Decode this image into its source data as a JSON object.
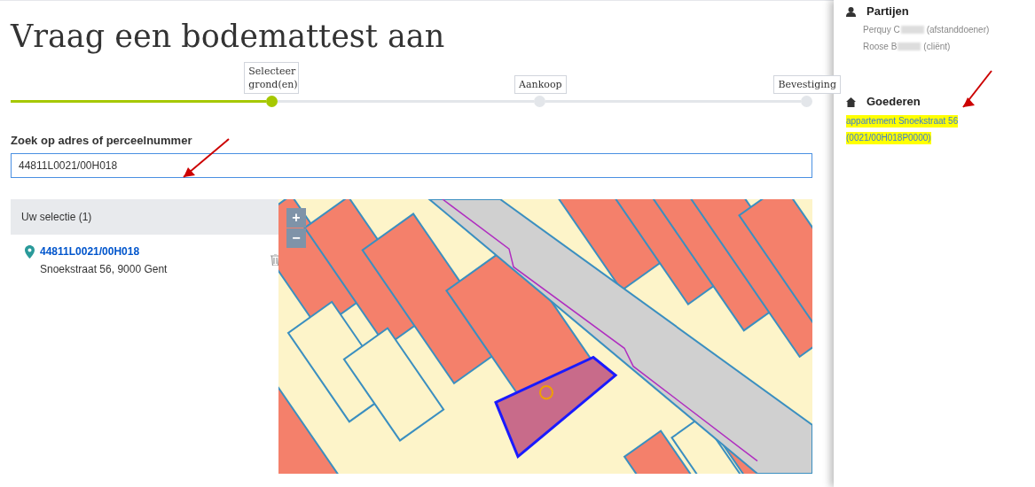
{
  "page_title": "Vraag een bodemattest aan",
  "steps": [
    {
      "label": "Selecteer grond(en)",
      "selected": true
    },
    {
      "label": "Aankoop",
      "selected": false
    },
    {
      "label": "Bevestiging",
      "selected": false
    }
  ],
  "search": {
    "label": "Zoek op adres of perceelnummer",
    "value": "44811L0021/00H018"
  },
  "selection": {
    "title": "Uw selectie (1)",
    "items": [
      {
        "parcel": "44811L0021/00H018",
        "address": "Snoekstraat 56, 9000 Gent"
      }
    ]
  },
  "map": {
    "zoom_in": "+",
    "zoom_out": "−"
  },
  "sidebar": {
    "parties_title": "Partijen",
    "parties": [
      {
        "name": "Perquy C",
        "role": "(afstanddoener)"
      },
      {
        "name": "Roose B",
        "role": "(cliënt)"
      }
    ],
    "goods_title": "Goederen",
    "goods": [
      "appartement Snoekstraat 56",
      "(0021/00H018P0000)"
    ]
  }
}
